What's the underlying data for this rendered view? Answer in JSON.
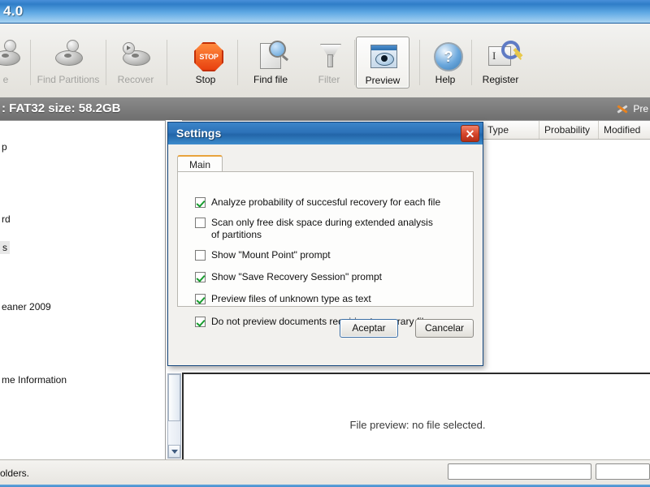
{
  "window": {
    "title": "4.0"
  },
  "toolbar": {
    "buttons": [
      {
        "label": "e",
        "icon": "disc-icon",
        "enabled": false,
        "selected": false
      },
      {
        "label": "Find Partitions",
        "icon": "find-partitions-icon",
        "enabled": false,
        "selected": false
      },
      {
        "label": "Recover",
        "icon": "recover-icon",
        "enabled": false,
        "selected": false
      },
      {
        "label": "Stop",
        "icon": "stop-icon",
        "enabled": true,
        "selected": false
      },
      {
        "label": "Find file",
        "icon": "find-file-icon",
        "enabled": true,
        "selected": false
      },
      {
        "label": "Filter",
        "icon": "filter-icon",
        "enabled": false,
        "selected": false
      },
      {
        "label": "Preview",
        "icon": "preview-eye-icon",
        "enabled": true,
        "selected": true
      },
      {
        "label": "Help",
        "icon": "help-icon",
        "enabled": true,
        "selected": false
      },
      {
        "label": "Register",
        "icon": "register-key-icon",
        "enabled": true,
        "selected": false
      }
    ]
  },
  "infostrip": {
    "text": ": FAT32 size: 58.2GB",
    "preferences_label": "Pre",
    "preferences_icon": "wrench-tools-icon"
  },
  "tree": {
    "nodes": [
      {
        "label": "p",
        "selected": false
      },
      {
        "label": "rd",
        "selected": false
      },
      {
        "label": "s",
        "selected": true
      },
      {
        "label": "eaner 2009",
        "selected": false
      },
      {
        "label": "me Information",
        "selected": false
      }
    ]
  },
  "filelist": {
    "columns": [
      "Type",
      "Probability",
      "Modified"
    ]
  },
  "preview": {
    "message": "File preview: no file selected."
  },
  "statusbar": {
    "message": "olders."
  },
  "dialog": {
    "title": "Settings",
    "close_icon": "close-icon",
    "tabs": [
      {
        "label": "Main",
        "active": true
      }
    ],
    "options": [
      {
        "label": "Analyze probability of succesful recovery for each file",
        "checked": true
      },
      {
        "label": "Scan only free disk space during extended analysis\nof partitions",
        "checked": false
      },
      {
        "label": "Show \"Mount Point\" prompt",
        "checked": false
      },
      {
        "label": "Show \"Save Recovery Session\" prompt",
        "checked": true
      },
      {
        "label": "Preview files of unknown type as text",
        "checked": true
      },
      {
        "label": "Do not preview documents requiring temporary files",
        "checked": true
      }
    ],
    "accept_label": "Aceptar",
    "cancel_label": "Cancelar"
  },
  "colors": {
    "title_blue": "#2c72b8",
    "accent_orange": "#e8a33d",
    "check_green": "#179c2e",
    "close_red": "#d5442a",
    "info_gray": "#6f6f6f"
  }
}
